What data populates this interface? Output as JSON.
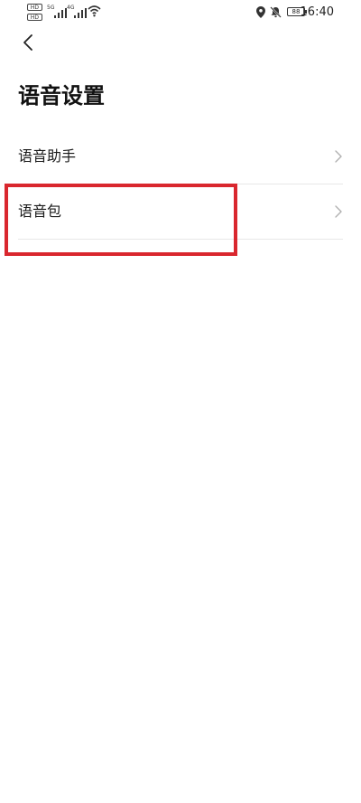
{
  "status_bar": {
    "hd_badge_1": "HD",
    "hd_badge_2": "HD",
    "signal_1_label": "5G",
    "signal_2_label": "4G",
    "battery_level": "88",
    "time": "16:40",
    "icons": [
      "hd-icon",
      "signal-icon",
      "wifi-icon",
      "location-icon",
      "mute-bell-icon",
      "battery-icon"
    ]
  },
  "header": {
    "back_icon": "chevron-left-icon",
    "title": "语音设置"
  },
  "settings": {
    "items": [
      {
        "label": "语音助手",
        "icon": "chevron-right-icon"
      },
      {
        "label": "语音包",
        "icon": "chevron-right-icon"
      }
    ]
  },
  "annotation": {
    "highlight_color": "#d9272e",
    "highlighted_item": "语音包"
  },
  "colors": {
    "background": "#ffffff",
    "text": "#111111",
    "divider": "#e8e8e8",
    "chevron": "#b0b0b0"
  }
}
